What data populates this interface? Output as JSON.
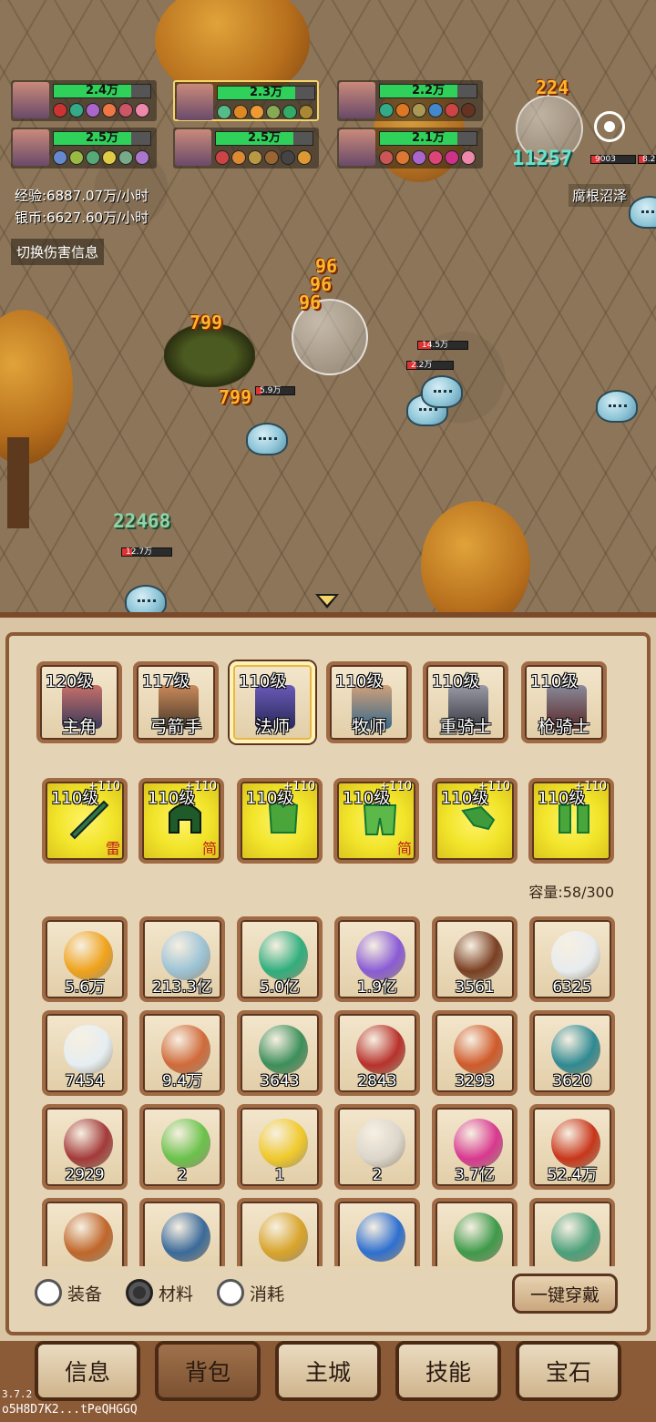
{
  "party": [
    {
      "hp": "2.4万",
      "selected": false
    },
    {
      "hp": "2.3万",
      "selected": true
    },
    {
      "hp": "2.2万",
      "selected": false
    },
    {
      "hp": "2.5万",
      "selected": false
    },
    {
      "hp": "2.5万",
      "selected": false
    },
    {
      "hp": "2.1万",
      "selected": false
    }
  ],
  "stats": {
    "exp": "经验:6887.07万/小时",
    "silver": "银币:6627.60万/小时"
  },
  "toggle_damage_label": "切换伤害信息",
  "location": "腐根沼泽",
  "battle": {
    "damage_numbers": [
      "224",
      "11257",
      "96",
      "96",
      "96",
      "799",
      "799",
      "22468"
    ],
    "enemy_hp": [
      "14.5万",
      "2.2万",
      "5.9万",
      "12.7万",
      "9003",
      "8.2"
    ]
  },
  "heroes": [
    {
      "level": "120级",
      "class": "主角",
      "active": false
    },
    {
      "level": "117级",
      "class": "弓箭手",
      "active": false
    },
    {
      "level": "110级",
      "class": "法师",
      "active": true
    },
    {
      "level": "110级",
      "class": "牧师",
      "active": false
    },
    {
      "level": "110级",
      "class": "重骑士",
      "active": false
    },
    {
      "level": "110级",
      "class": "枪骑士",
      "active": false
    }
  ],
  "gear": [
    {
      "level": "110级",
      "plus": "+110",
      "tag": "雷",
      "icon": "sword-icon"
    },
    {
      "level": "110级",
      "plus": "+110",
      "tag": "简",
      "icon": "helmet-icon"
    },
    {
      "level": "110级",
      "plus": "+110",
      "tag": "",
      "icon": "armor-icon"
    },
    {
      "level": "110级",
      "plus": "+110",
      "tag": "简",
      "icon": "leg-armor-icon"
    },
    {
      "level": "110级",
      "plus": "+110",
      "tag": "",
      "icon": "gloves-icon"
    },
    {
      "level": "110级",
      "plus": "+110",
      "tag": "",
      "icon": "boots-icon"
    }
  ],
  "capacity": "容量:58/300",
  "items": [
    {
      "count": "5.6万",
      "icon": "gold-coin-icon",
      "color": "#f0a21a"
    },
    {
      "count": "213.3亿",
      "icon": "silver-coin-icon",
      "color": "#9cc3d6"
    },
    {
      "count": "5.0亿",
      "icon": "green-orb-icon",
      "color": "#2fae7c"
    },
    {
      "count": "1.9亿",
      "icon": "purple-crystal-icon",
      "color": "#8a5bd6"
    },
    {
      "count": "3561",
      "icon": "tree-stump-icon",
      "color": "#7a3f22"
    },
    {
      "count": "6325",
      "icon": "fang-icon",
      "color": "#e8ecef"
    },
    {
      "count": "7454",
      "icon": "feather-icon",
      "color": "#e6eef2"
    },
    {
      "count": "9.4万",
      "icon": "rune-stone-icon",
      "color": "#d06a3a"
    },
    {
      "count": "3643",
      "icon": "scroll-green-icon",
      "color": "#3c8f5a"
    },
    {
      "count": "2843",
      "icon": "scroll-red-icon",
      "color": "#b8322c"
    },
    {
      "count": "3293",
      "icon": "scroll-orange-icon",
      "color": "#d05a2a"
    },
    {
      "count": "3620",
      "icon": "scroll-teal-icon",
      "color": "#2f8a92"
    },
    {
      "count": "2929",
      "icon": "scroll-crimson-icon",
      "color": "#a33a3a"
    },
    {
      "count": "2",
      "icon": "green-leaf-icon",
      "color": "#6ac24a"
    },
    {
      "count": "1",
      "icon": "yellow-leaf-icon",
      "color": "#f0c92a"
    },
    {
      "count": "2",
      "icon": "mask-icon",
      "color": "#dcd6cc"
    },
    {
      "count": "3.7亿",
      "icon": "pink-gem-icon",
      "color": "#d8388f"
    },
    {
      "count": "52.4万",
      "icon": "lava-orb-icon",
      "color": "#c8361a"
    },
    {
      "count": "",
      "icon": "wood-ring-icon",
      "color": "#c0662a"
    },
    {
      "count": "",
      "icon": "shield-icon",
      "color": "#3a6a9a"
    },
    {
      "count": "",
      "icon": "key-icon",
      "color": "#d8a42a"
    },
    {
      "count": "",
      "icon": "blue-ore-icon",
      "color": "#2e6fd0"
    },
    {
      "count": "",
      "icon": "green-stone-icon",
      "color": "#3e9a4a"
    },
    {
      "count": "",
      "icon": "jade-stone-icon",
      "color": "#4aa07a"
    }
  ],
  "filters": [
    {
      "label": "装备",
      "selected": false
    },
    {
      "label": "材料",
      "selected": true
    },
    {
      "label": "消耗",
      "selected": false
    }
  ],
  "equip_all_label": "一键穿戴",
  "nav": [
    {
      "label": "信息",
      "active": false
    },
    {
      "label": "背包",
      "active": true
    },
    {
      "label": "主城",
      "active": false
    },
    {
      "label": "技能",
      "active": false
    },
    {
      "label": "宝石",
      "active": false
    }
  ],
  "version": "3.7.2",
  "build_id": "o5H8D7K2...tPeQHGGQ"
}
